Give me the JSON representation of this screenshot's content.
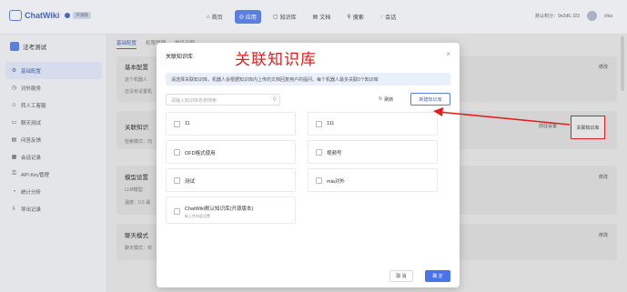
{
  "topbar": {
    "logo_text": "ChatWiki",
    "logo_badge": "开源版",
    "nav": [
      {
        "icon": "⌂",
        "label": "首页",
        "active": false
      },
      {
        "icon": "◎",
        "label": "应用",
        "active": true
      },
      {
        "icon": "▢",
        "label": "知识库",
        "active": false
      },
      {
        "icon": "▤",
        "label": "文档",
        "active": false
      },
      {
        "icon": "⚲",
        "label": "搜索",
        "active": false
      },
      {
        "icon": "◌",
        "label": "会话",
        "active": false
      }
    ],
    "account": "默认积分：9e2d6..f23",
    "username": "chia"
  },
  "sidebar": {
    "bot_name": "法考测试",
    "items": [
      {
        "icon": "⚙",
        "label": "基础配置",
        "active": true
      },
      {
        "icon": "◷",
        "label": "对外服务",
        "active": false
      },
      {
        "icon": "☺",
        "label": "转人工客服",
        "active": false
      },
      {
        "icon": "▭",
        "label": "聊天测试",
        "active": false
      },
      {
        "icon": "▤",
        "label": "问答反馈",
        "active": false
      },
      {
        "icon": "▦",
        "label": "会话记录",
        "active": false
      },
      {
        "icon": "⚿",
        "label": "API Key管理",
        "active": false
      },
      {
        "icon": "◔",
        "label": "统计分析",
        "active": false
      },
      {
        "icon": "⇩",
        "label": "导出记录",
        "active": false
      }
    ]
  },
  "main": {
    "tabs": [
      "基础配置",
      "权限管理",
      "常见问题"
    ],
    "cards": [
      {
        "title": "基本配置",
        "sub": "这个机器人",
        "sub2": "还没有设置机",
        "edit": "修改"
      },
      {
        "title": "关联知识",
        "sub": "检索模式：向",
        "edit": "",
        "side_prefix": "前往设置",
        "side_btn": "关联知识库"
      },
      {
        "title": "模型设置",
        "sub": "LLM模型：",
        "sub2": "温度：0.5  最",
        "edit": "修改"
      },
      {
        "title": "聊天模式",
        "sub": "聊天模式：仅",
        "edit": "修改"
      }
    ]
  },
  "modal": {
    "title": "关联知识库",
    "annotation": "关联知识库",
    "notice": "请选择关联知识库，机器人会根据知识库内上传的文档回复用户的提问。每个机器人最多关联5个知识库",
    "search_placeholder": "请输入知识库名称搜索",
    "refresh_label": "刷新",
    "new_label": "新建知识库",
    "items": [
      {
        "name": "11",
        "desc": ""
      },
      {
        "name": "111",
        "desc": ""
      },
      {
        "name": "OFD格式使用",
        "desc": ""
      },
      {
        "name": "视频号",
        "desc": ""
      },
      {
        "name": "测试",
        "desc": ""
      },
      {
        "name": "mia对外",
        "desc": ""
      },
      {
        "name": "ChatWiki默认知识库(开源版本)",
        "desc": "新上传内容设置"
      }
    ],
    "cancel_label": "取 消",
    "ok_label": "确 定"
  },
  "colors": {
    "accent": "#4a73e8",
    "annotation": "#e02020"
  }
}
